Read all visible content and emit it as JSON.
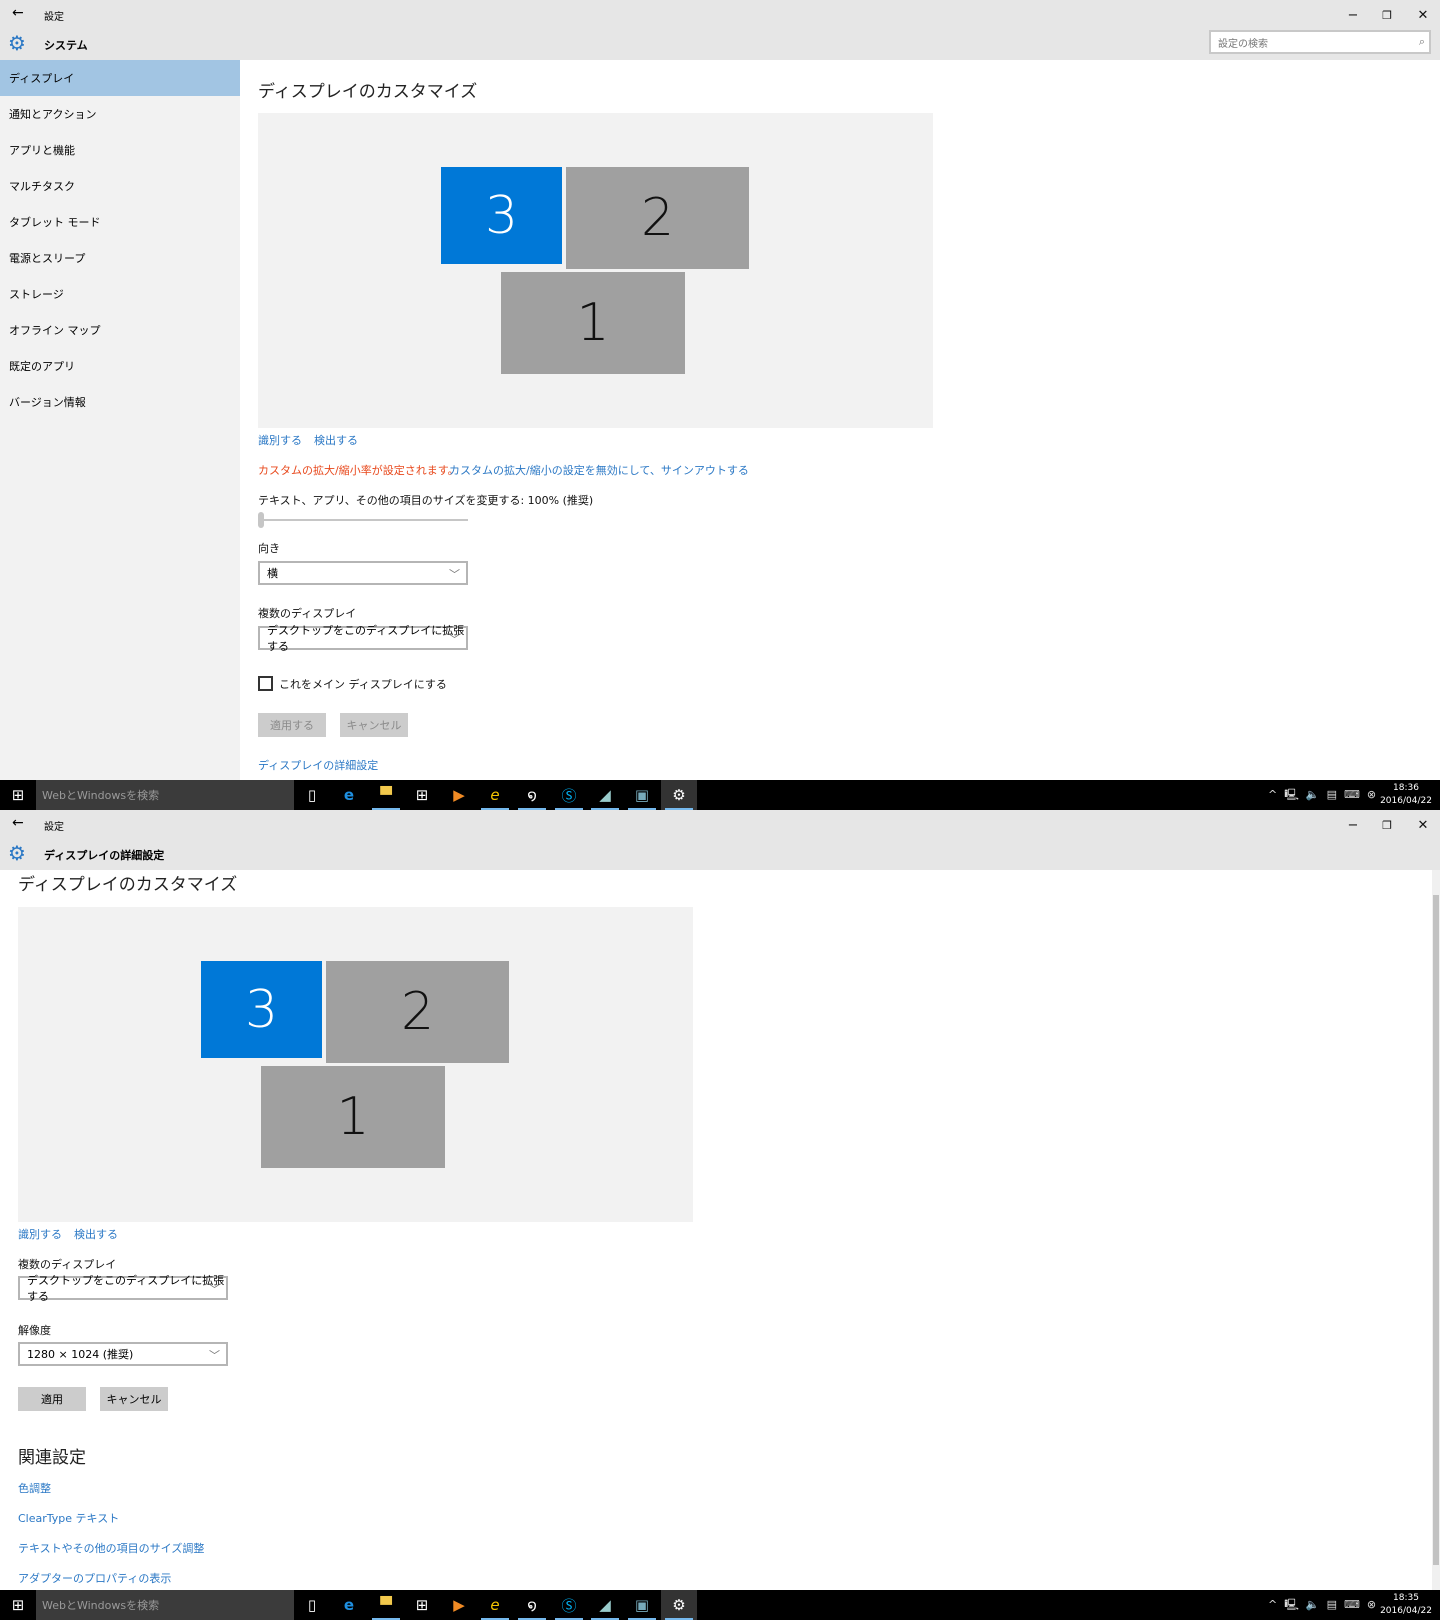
{
  "window1": {
    "title": "設定",
    "header": "システム",
    "search_placeholder": "設定の検索",
    "sidebar": [
      "ディスプレイ",
      "通知とアクション",
      "アプリと機能",
      "マルチタスク",
      "タブレット モード",
      "電源とスリープ",
      "ストレージ",
      "オフライン マップ",
      "既定のアプリ",
      "バージョン情報"
    ],
    "heading": "ディスプレイのカスタマイズ",
    "monitors": [
      "3",
      "2",
      "1"
    ],
    "identify": "識別する",
    "detect": "検出する",
    "warning": "カスタムの拡大/縮小率が設定されます。",
    "signout_link": "カスタムの拡大/縮小の設定を無効にして、サインアウトする",
    "scale_label": "テキスト、アプリ、その他の項目のサイズを変更する: 100% (推奨)",
    "scale_value": 0,
    "orientation_label": "向き",
    "orientation_value": "横",
    "multi_label": "複数のディスプレイ",
    "multi_value": "デスクトップをこのディスプレイに拡張する",
    "main_checkbox": "これをメイン ディスプレイにする",
    "apply": "適用する",
    "cancel": "キャンセル",
    "advanced_link": "ディスプレイの詳細設定"
  },
  "window2": {
    "title": "設定",
    "header": "ディスプレイの詳細設定",
    "heading": "ディスプレイのカスタマイズ",
    "monitors": [
      "3",
      "2",
      "1"
    ],
    "identify": "識別する",
    "detect": "検出する",
    "multi_label": "複数のディスプレイ",
    "multi_value": "デスクトップをこのディスプレイに拡張する",
    "resolution_label": "解像度",
    "resolution_value": "1280 × 1024 (推奨)",
    "apply": "適用",
    "cancel": "キャンセル",
    "related_heading": "関連設定",
    "related_links": [
      "色調整",
      "ClearType テキスト",
      "テキストやその他の項目のサイズ調整",
      "アダプターのプロパティの表示"
    ]
  },
  "taskbar1": {
    "search": "WebとWindowsを検索",
    "time": "18:36",
    "date": "2016/04/22"
  },
  "taskbar2": {
    "search": "WebとWindowsを検索",
    "time": "18:35",
    "date": "2016/04/22"
  },
  "colors": {
    "accent": "#0078d7",
    "selected_nav": "#a2c5e3",
    "link": "#2b78c5",
    "warning": "#e8491d"
  }
}
